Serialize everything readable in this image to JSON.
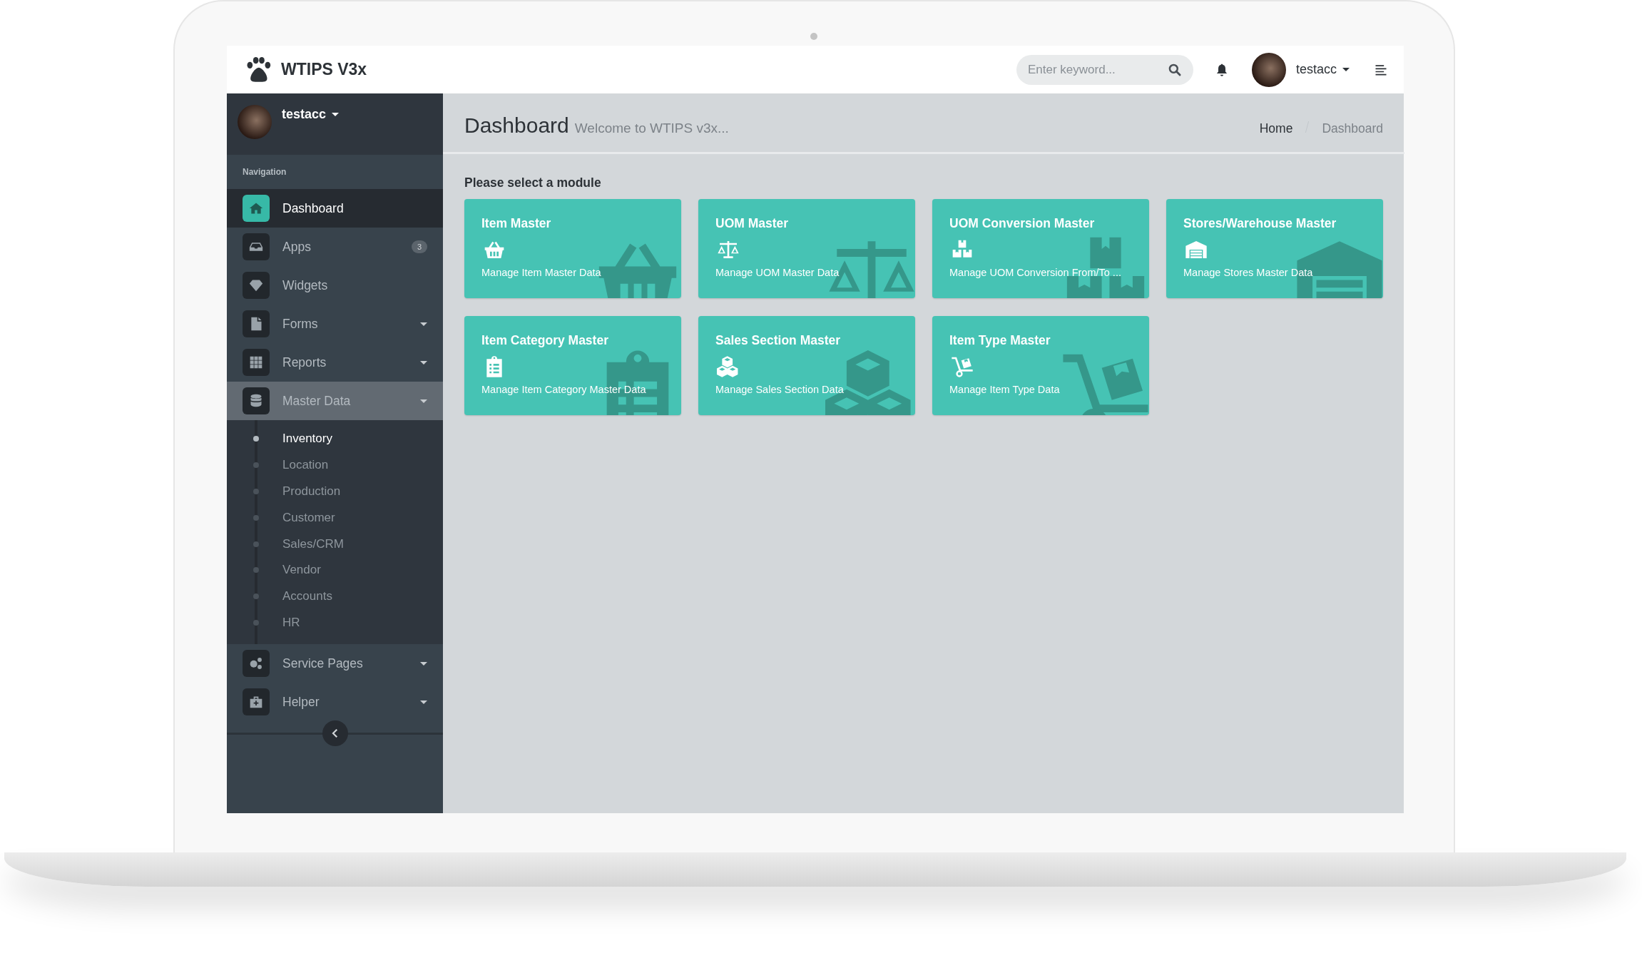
{
  "header": {
    "logo": "WTIPS V3x",
    "search": {
      "placeholder": "Enter keyword..."
    },
    "user": "testacc"
  },
  "sidebar": {
    "user": "testacc",
    "section_label": "Navigation",
    "items": [
      {
        "label": "Dashboard",
        "selected": true,
        "expandable": false,
        "expanded": false
      },
      {
        "label": "Apps",
        "selected": false,
        "expandable": false,
        "expanded": false,
        "badge": "3"
      },
      {
        "label": "Widgets",
        "selected": false,
        "expandable": false,
        "expanded": false
      },
      {
        "label": "Forms",
        "selected": false,
        "expandable": true,
        "expanded": false
      },
      {
        "label": "Reports",
        "selected": false,
        "expandable": true,
        "expanded": false
      },
      {
        "label": "Master Data",
        "selected": false,
        "expandable": true,
        "expanded": true,
        "children": [
          {
            "label": "Inventory",
            "selected": true
          },
          {
            "label": "Location",
            "selected": false
          },
          {
            "label": "Production",
            "selected": false
          },
          {
            "label": "Customer",
            "selected": false
          },
          {
            "label": "Sales/CRM",
            "selected": false
          },
          {
            "label": "Vendor",
            "selected": false
          },
          {
            "label": "Accounts",
            "selected": false
          },
          {
            "label": "HR",
            "selected": false
          }
        ]
      },
      {
        "label": "Service Pages",
        "selected": false,
        "expandable": true,
        "expanded": false
      },
      {
        "label": "Helper",
        "selected": false,
        "expandable": true,
        "expanded": false
      }
    ]
  },
  "page": {
    "title": "Dashboard",
    "subtitle": "Welcome to WTIPS v3x...",
    "breadcrumb": [
      {
        "label": "Home",
        "selected": false
      },
      {
        "label": "Dashboard",
        "selected": true
      }
    ],
    "prompt": "Please select a module",
    "modules": [
      {
        "title": "Item Master",
        "description": "Manage Item Master Data"
      },
      {
        "title": "UOM Master",
        "description": "Manage UOM Master Data"
      },
      {
        "title": "UOM Conversion Master",
        "description": "Manage UOM Conversion From/To ..."
      },
      {
        "title": "Stores/Warehouse Master",
        "description": "Manage Stores Master Data"
      },
      {
        "title": "Item Category Master",
        "description": "Manage Item Category Master Data"
      },
      {
        "title": "Sales Section Master",
        "description": "Manage Sales Section Data"
      },
      {
        "title": "Item Type Master",
        "description": "Manage Item Type Data"
      }
    ]
  }
}
